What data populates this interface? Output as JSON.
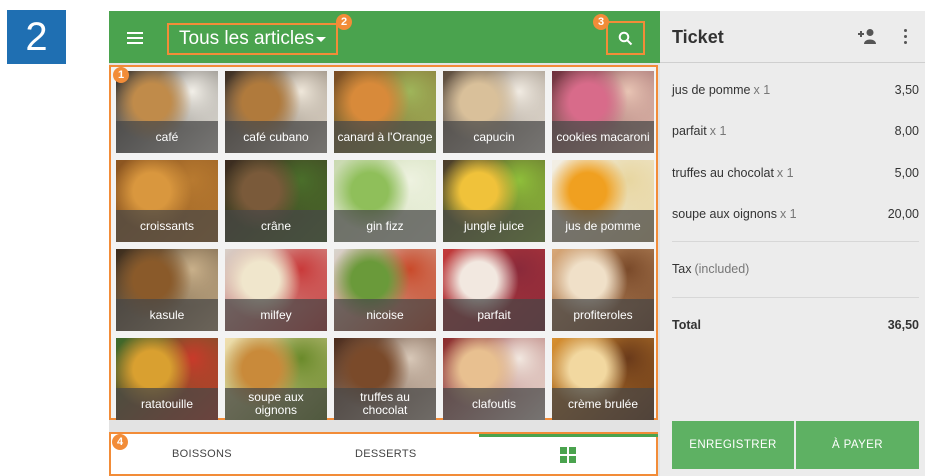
{
  "step": {
    "number": "2"
  },
  "callouts": {
    "c1": "1",
    "c2": "2",
    "c3": "3",
    "c4": "4"
  },
  "colors": {
    "appbar": "#4aa34e",
    "highlight": "#f28c38",
    "button": "#5eb163",
    "badge": "#1f6fb2"
  },
  "header": {
    "category": "Tous les articles",
    "menu_icon": "hamburger-menu-icon",
    "search_icon": "search-icon"
  },
  "items": [
    {
      "label": "café",
      "colors": [
        "#2f2a25",
        "#c08b4a",
        "#f2efe8"
      ]
    },
    {
      "label": "café cubano",
      "colors": [
        "#3a2b1e",
        "#b07a3c",
        "#efe7da"
      ]
    },
    {
      "label": "canard à l'Orange",
      "colors": [
        "#7a4a22",
        "#d88a3a",
        "#9fb55a"
      ]
    },
    {
      "label": "capucin",
      "colors": [
        "#5a4a3a",
        "#d9c09a",
        "#f1ebe2"
      ]
    },
    {
      "label": "cookies macaroni",
      "colors": [
        "#6e2f3c",
        "#d86b8a",
        "#e8c4b4"
      ]
    },
    {
      "label": "croissants",
      "colors": [
        "#8a5420",
        "#d9973e",
        "#b87a30"
      ]
    },
    {
      "label": "crâne",
      "colors": [
        "#3b2a20",
        "#7a5a3a",
        "#4a6e2a"
      ]
    },
    {
      "label": "gin fizz",
      "colors": [
        "#c9d9b0",
        "#8fbf5a",
        "#eef2e0"
      ]
    },
    {
      "label": "jungle juice",
      "colors": [
        "#4a3a2a",
        "#f0c23a",
        "#8fbf3a"
      ]
    },
    {
      "label": "jus de pomme",
      "colors": [
        "#f2efe6",
        "#f0a020",
        "#e8d6a0"
      ]
    },
    {
      "label": "kasule",
      "colors": [
        "#3a2a1a",
        "#8a5a2a",
        "#c9b08a"
      ]
    },
    {
      "label": "milfey",
      "colors": [
        "#d8d0c8",
        "#f0e6cc",
        "#c93a3a"
      ]
    },
    {
      "label": "nicoise",
      "colors": [
        "#d9d6cf",
        "#6a9a3a",
        "#c94a2a"
      ]
    },
    {
      "label": "parfait",
      "colors": [
        "#c23a3a",
        "#f2e8e0",
        "#8a2a3a"
      ]
    },
    {
      "label": "profiteroles",
      "colors": [
        "#d8a878",
        "#f0e0c8",
        "#7a4a2a"
      ]
    },
    {
      "label": "ratatouille",
      "colors": [
        "#3a6a2a",
        "#d9a030",
        "#c93a2a"
      ]
    },
    {
      "label": "soupe aux oignons",
      "colors": [
        "#f2e0b0",
        "#c98a3a",
        "#6a8a2a"
      ]
    },
    {
      "label": "truffes au chocolat",
      "colors": [
        "#4a2a1a",
        "#7a4a2a",
        "#d8c8b8"
      ]
    },
    {
      "label": "clafoutis",
      "colors": [
        "#8a2a2a",
        "#e8c090",
        "#f2e8e0"
      ]
    },
    {
      "label": "crème brulée",
      "colors": [
        "#d89030",
        "#f2d8a0",
        "#6a3a1a"
      ]
    }
  ],
  "bottom_tabs": {
    "boissons": "BOISSONS",
    "desserts": "DESSERTS",
    "grid_icon": "grid-view-icon"
  },
  "ticket": {
    "title": "Ticket",
    "add_customer_icon": "add-person-icon",
    "more_icon": "more-vert-icon",
    "lines": [
      {
        "name": "jus de pomme",
        "qty": "x 1",
        "price": "3,50"
      },
      {
        "name": "parfait",
        "qty": "x 1",
        "price": "8,00"
      },
      {
        "name": "truffes au chocolat",
        "qty": "x 1",
        "price": "5,00"
      },
      {
        "name": "soupe aux oignons",
        "qty": "x 1",
        "price": "20,00"
      }
    ],
    "tax_label": "Tax",
    "tax_note": "(included)",
    "total_label": "Total",
    "total_value": "36,50",
    "save_button": "ENREGISTRER",
    "pay_button": "À PAYER"
  }
}
